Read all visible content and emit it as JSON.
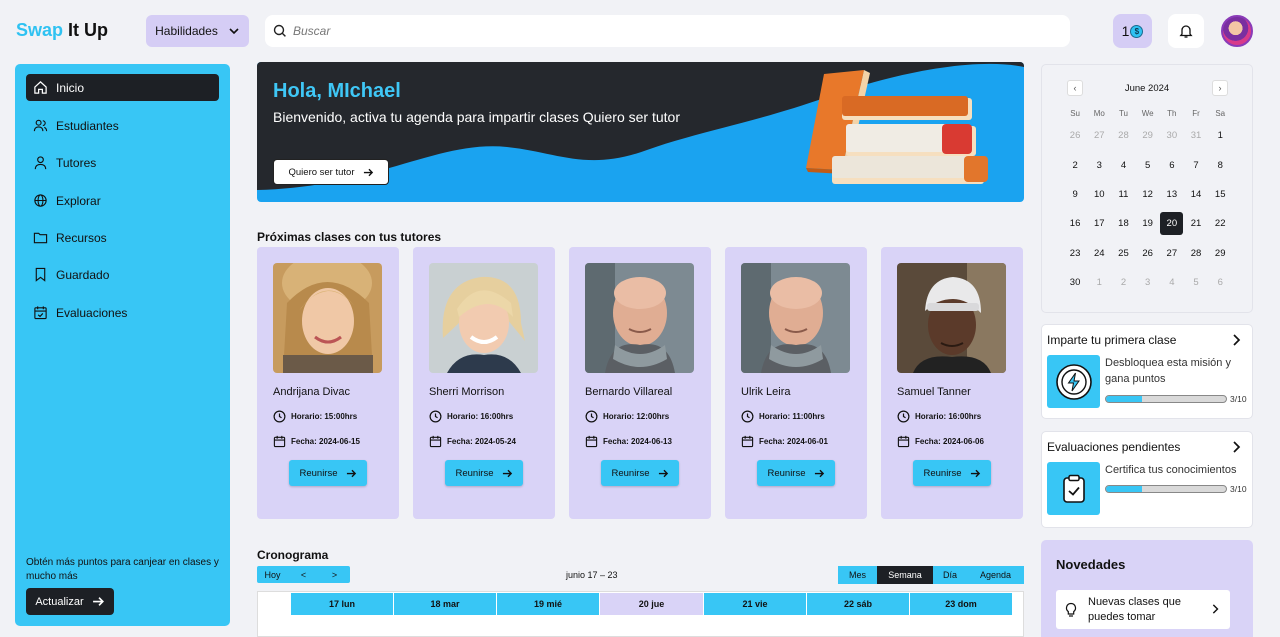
{
  "header": {
    "logo_a": "Swap",
    "logo_b": "It Up",
    "skills_label": "Habilidades",
    "search_placeholder": "Buscar",
    "points": "1"
  },
  "sidebar": {
    "items": [
      {
        "label": "Inicio",
        "icon": "home-icon"
      },
      {
        "label": "Estudiantes",
        "icon": "users-icon"
      },
      {
        "label": "Tutores",
        "icon": "user-icon"
      },
      {
        "label": "Explorar",
        "icon": "globe-icon"
      },
      {
        "label": "Recursos",
        "icon": "folder-icon"
      },
      {
        "label": "Guardado",
        "icon": "bookmark-icon"
      },
      {
        "label": "Evaluaciones",
        "icon": "calendar-check-icon"
      }
    ],
    "note": "Obtén más puntos para canjear en clases y mucho más",
    "upgrade_label": "Actualizar"
  },
  "banner": {
    "greeting": "Hola, MIchael",
    "welcome": "Bienvenido, activa tu agenda para impartir clases Quiero ser tutor",
    "button": "Quiero ser tutor"
  },
  "upcoming": {
    "title": "Próximas clases con tus tutores",
    "cards": [
      {
        "name": "Andrijana Divac",
        "horario": "Horario: 15:00hrs",
        "fecha": "Fecha: 2024-06-15",
        "button": "Reunirse"
      },
      {
        "name": "Sherri Morrison",
        "horario": "Horario: 16:00hrs",
        "fecha": "Fecha: 2024-05-24",
        "button": "Reunirse"
      },
      {
        "name": "Bernardo Villareal",
        "horario": "Horario: 12:00hrs",
        "fecha": "Fecha: 2024-06-13",
        "button": "Reunirse"
      },
      {
        "name": "Ulrik Leira",
        "horario": "Horario: 11:00hrs",
        "fecha": "Fecha: 2024-06-01",
        "button": "Reunirse"
      },
      {
        "name": "Samuel Tanner",
        "horario": "Horario: 16:00hrs",
        "fecha": "Fecha: 2024-06-06",
        "button": "Reunirse"
      }
    ]
  },
  "schedule": {
    "title": "Cronograma",
    "today": "Hoy",
    "prev": "<",
    "next": ">",
    "range": "junio 17 – 23",
    "views": [
      "Mes",
      "Semana",
      "Día",
      "Agenda"
    ],
    "active_view": "Semana",
    "days": [
      "17 lun",
      "18 mar",
      "19 mié",
      "20 jue",
      "21 vie",
      "22 sáb",
      "23 dom"
    ],
    "today_day": "20 jue"
  },
  "calendar": {
    "title": "June 2024",
    "dow": [
      "Su",
      "Mo",
      "Tu",
      "We",
      "Th",
      "Fr",
      "Sa"
    ],
    "weeks": [
      [
        "26",
        "27",
        "28",
        "29",
        "30",
        "31",
        "1"
      ],
      [
        "2",
        "3",
        "4",
        "5",
        "6",
        "7",
        "8"
      ],
      [
        "9",
        "10",
        "11",
        "12",
        "13",
        "14",
        "15"
      ],
      [
        "16",
        "17",
        "18",
        "19",
        "20",
        "21",
        "22"
      ],
      [
        "23",
        "24",
        "25",
        "26",
        "27",
        "28",
        "29"
      ],
      [
        "30",
        "1",
        "2",
        "3",
        "4",
        "5",
        "6"
      ]
    ],
    "selected": "20"
  },
  "missions": [
    {
      "title": "Imparte tu primera clase",
      "desc": "Desbloquea esta misión y gana puntos",
      "count": "3/10",
      "progress": 0.3,
      "icon": "bolt-icon"
    },
    {
      "title": "Evaluaciones pendientes",
      "desc": "Certifica tus conocimientos",
      "count": "3/10",
      "progress": 0.3,
      "icon": "clipboard-check-icon"
    }
  ],
  "news": {
    "title": "Novedades",
    "item": "Nuevas clases que puedes tomar"
  },
  "colors": {
    "accent": "#38c6f5",
    "lavender": "#d9d3f7",
    "dark": "#1d2025"
  }
}
